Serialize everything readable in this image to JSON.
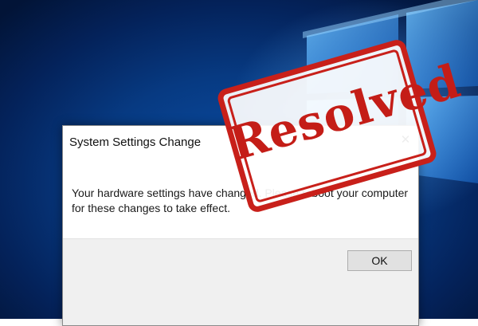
{
  "dialog": {
    "title": "System Settings Change",
    "close_glyph": "✕",
    "message": "Your hardware settings have changed. Please reboot your computer for these changes to take effect.",
    "ok_label": "OK"
  },
  "stamp": {
    "text": "Resolved",
    "color": "#c8201a"
  },
  "desktop": {
    "wallpaper": "windows-10-logo",
    "accent": "#0a4fa8"
  }
}
